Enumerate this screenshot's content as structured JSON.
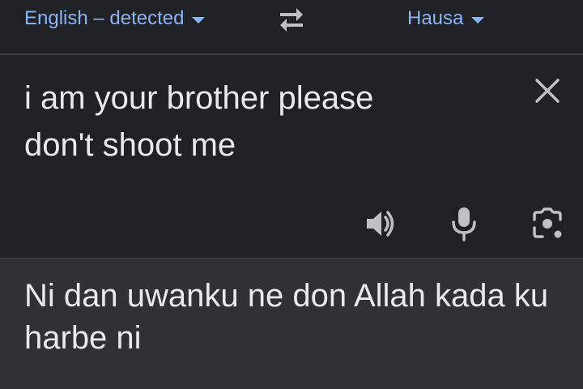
{
  "language_bar": {
    "source_language": "English – detected",
    "target_language": "Hausa",
    "swap_icon": "swap-arrows-icon"
  },
  "input": {
    "text": "i am your brother please\ndon't shoot me",
    "clear_icon": "close-icon",
    "tools": [
      "speaker-icon",
      "microphone-icon",
      "camera-lens-icon"
    ]
  },
  "output": {
    "text": "Ni dan uwanku ne don Allah kada ku harbe ni"
  },
  "colors": {
    "background": "#202124",
    "output_background": "#303134",
    "accent": "#8ab4f8",
    "text": "#e8eaed",
    "icon": "#bdc1c6"
  }
}
